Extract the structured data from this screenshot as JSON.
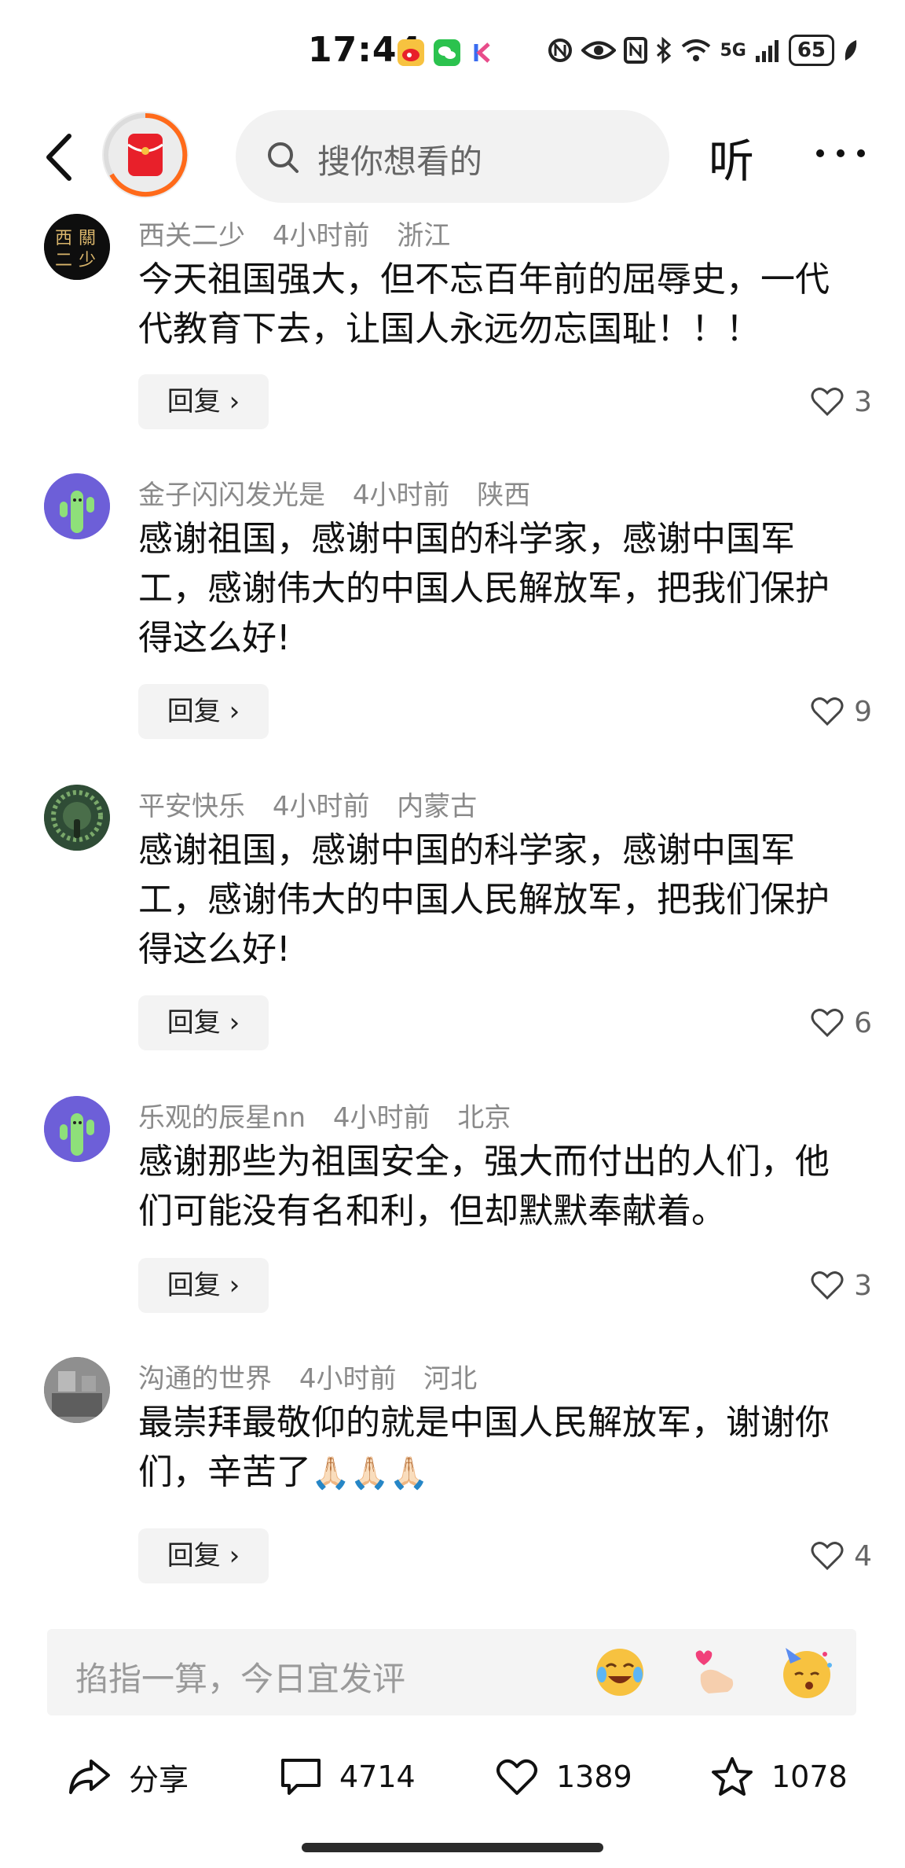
{
  "status_bar": {
    "time": "17:44",
    "network": "5G",
    "signal_icon": "signal-bars-icon",
    "battery": "65"
  },
  "header": {
    "search_placeholder": "搜你想看的",
    "listen_label": "听",
    "more_icon": "more-dots-icon",
    "back_icon": "back-chevron-icon"
  },
  "comments": [
    {
      "user": "西关二少",
      "time": "4小时前",
      "location": "浙江",
      "text": "今天祖国强大，但不忘百年前的屈辱史，一代代教育下去，让国人永远勿忘国耻！！！",
      "reply_label": "回复",
      "likes": "3"
    },
    {
      "user": "金子闪闪发光是",
      "time": "4小时前",
      "location": "陕西",
      "text": "感谢祖国，感谢中国的科学家，感谢中国军工，感谢伟大的中国人民解放军，把我们保护得这么好!",
      "reply_label": "回复",
      "likes": "9"
    },
    {
      "user": "平安快乐",
      "time": "4小时前",
      "location": "内蒙古",
      "text": "感谢祖国，感谢中国的科学家，感谢中国军工，感谢伟大的中国人民解放军，把我们保护得这么好!",
      "reply_label": "回复",
      "likes": "6"
    },
    {
      "user": "乐观的辰星nn",
      "time": "4小时前",
      "location": "北京",
      "text": "感谢那些为祖国安全，强大而付出的人们，他们可能没有名和利，但却默默奉献着。",
      "reply_label": "回复",
      "likes": "3"
    },
    {
      "user": "沟通的世界",
      "time": "4小时前",
      "location": "河北",
      "text": "最崇拜最敬仰的就是中国人民解放军，谢谢你们，辛苦了",
      "emojis": "🙏🏻🙏🏻🙏🏻",
      "reply_label": "回复",
      "likes": "4"
    }
  ],
  "input_bar": {
    "placeholder": "掐指一算，今日宜发评",
    "quick_emojis": [
      "laughing-crying-emoji",
      "finger-heart-emoji",
      "party-face-emoji"
    ]
  },
  "toolbar": {
    "share_label": "分享",
    "comments_count": "4714",
    "likes_count": "1389",
    "favorites_count": "1078"
  },
  "colors": {
    "accent_orange": "#ff6a1a",
    "brand_red": "#e8202a",
    "meta_gray": "#8a8a8a"
  }
}
